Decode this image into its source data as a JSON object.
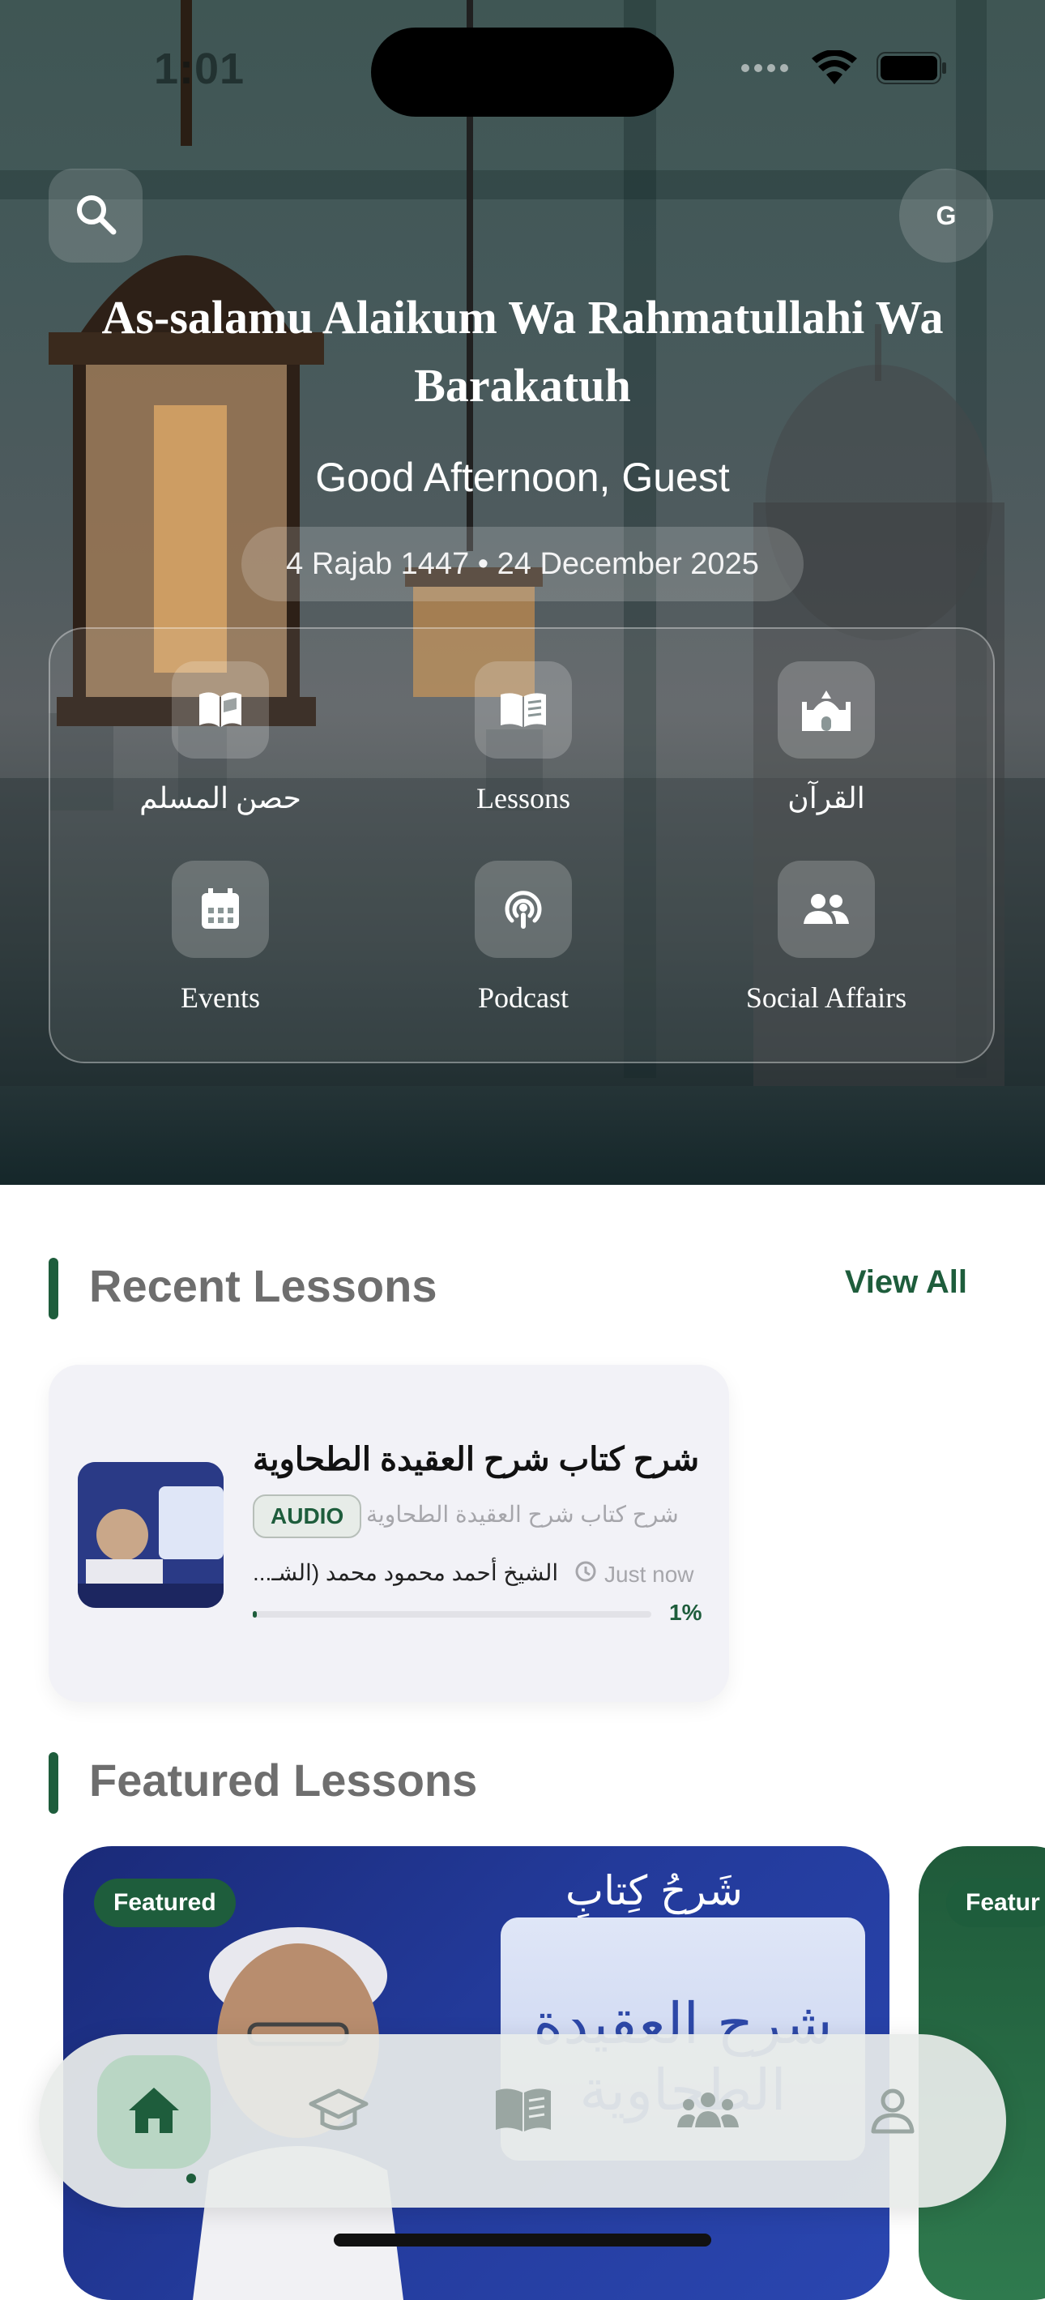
{
  "status_bar": {
    "time": "1:01"
  },
  "header": {
    "avatar_initial": "G",
    "greeting_arabic": "As-salamu Alaikum Wa Rahmatullahi Wa Barakatuh",
    "greeting": "Good Afternoon, Guest",
    "date": "4 Rajab 1447 • 24 December 2025"
  },
  "quick_actions": [
    {
      "label": "حصن المسلم",
      "icon": "open-book-icon"
    },
    {
      "label": "Lessons",
      "icon": "book-icon"
    },
    {
      "label": "القرآن",
      "icon": "mosque-icon"
    },
    {
      "label": "Events",
      "icon": "calendar-icon"
    },
    {
      "label": "Podcast",
      "icon": "podcast-icon"
    },
    {
      "label": "Social Affairs",
      "icon": "people-icon"
    }
  ],
  "recent": {
    "title": "Recent Lessons",
    "view_all": "View All",
    "lesson": {
      "title": "شرح كتاب شرح العقيدة الطحاوية",
      "badge": "AUDIO",
      "subtitle": "شرح كتاب شرح العقيدة الطحاوية",
      "author": "الشيخ أحمد محمود محمد (الشـ...",
      "time": "Just now",
      "progress": 0.01,
      "progress_label": "1%"
    }
  },
  "featured": {
    "title": "Featured Lessons",
    "badge": "Featured",
    "card_heading": "شَرحُ كِتابِ",
    "card_book_title": "شرح العقيدة الطحاوية",
    "second_badge": "Featur"
  },
  "tabbar": {
    "tabs": [
      "home-icon",
      "graduation-cap-icon",
      "book-icon",
      "community-icon",
      "profile-icon"
    ],
    "active_index": 0
  },
  "colors": {
    "accent": "#1e5d3c"
  }
}
